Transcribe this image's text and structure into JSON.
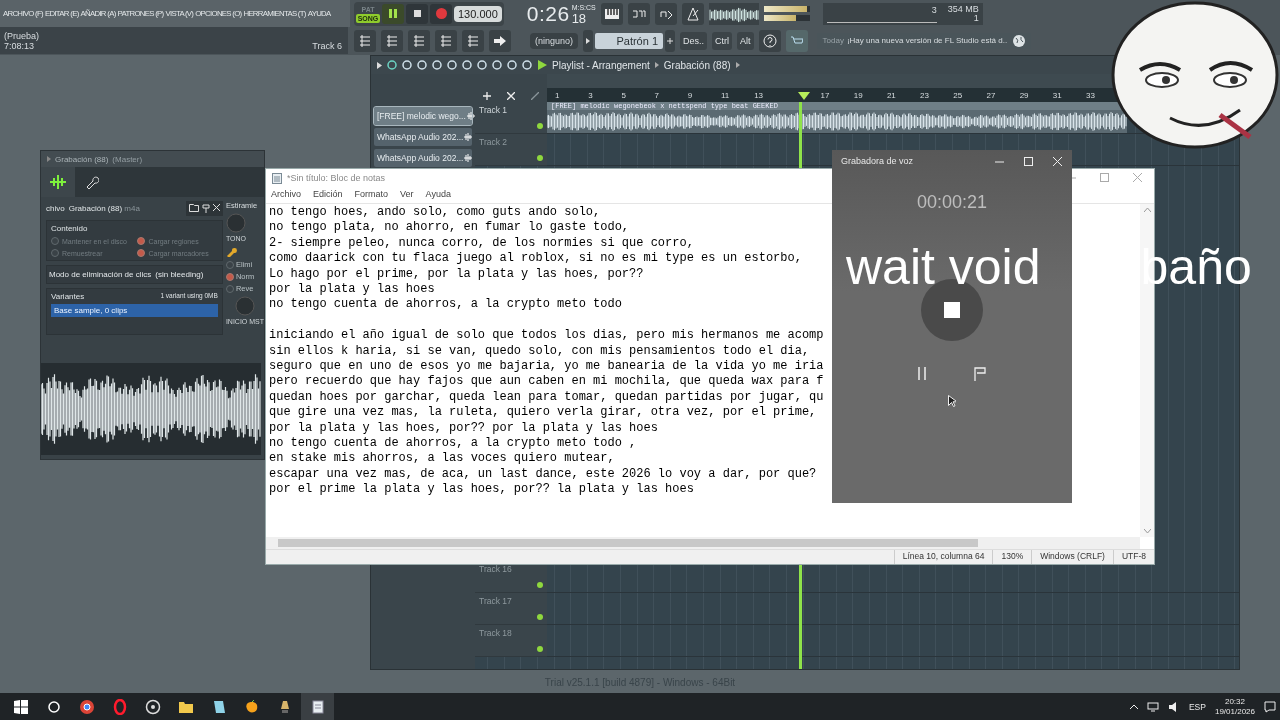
{
  "fl": {
    "menu": [
      "ARCHIVO (F)",
      "EDITAR (E)",
      "AÑADIR (A)",
      "PATRONES (P)",
      "VISTA (V)",
      "OPCIONES (O)",
      "HERRAMIENTAS (T)",
      "AYUDA"
    ],
    "hint": {
      "title": "(Prueba)",
      "value": "7:08:13",
      "track": "Track 6"
    },
    "transport": {
      "pat": "PAT",
      "song": "SONG",
      "song_mode": true,
      "playing": true,
      "tempo": "130.000",
      "time": "0:26",
      "time_cs": "18",
      "time_unit": "M:S:CS"
    },
    "sliders": [
      {
        "level": 0.93
      },
      {
        "level": 0.7
      }
    ],
    "monitor": {
      "cpu": "3",
      "memory": "354 MB",
      "polyphony": "1"
    },
    "pattern": {
      "none_label": "(ninguno)",
      "name": "Patrón 1"
    },
    "keys": [
      "Des..",
      "Ctrl",
      "Alt"
    ],
    "news": {
      "tag": "Today",
      "text": "¡Hay una nueva versión de FL Studio está d.."
    }
  },
  "playlist": {
    "title": "Playlist - Arrangement",
    "crumb": "Grabación (88)",
    "ruler": [
      {
        "kind": "number",
        "label": "1"
      },
      {
        "kind": "number",
        "label": "3"
      },
      {
        "kind": "number",
        "label": "5"
      },
      {
        "kind": "number",
        "label": "7"
      },
      {
        "kind": "number",
        "label": "9"
      },
      {
        "kind": "number",
        "label": "11"
      },
      {
        "kind": "number",
        "label": "13"
      },
      {
        "kind": "marker"
      },
      {
        "kind": "number",
        "label": "17"
      },
      {
        "kind": "number",
        "label": "19"
      },
      {
        "kind": "number",
        "label": "21"
      },
      {
        "kind": "number",
        "label": "23"
      },
      {
        "kind": "number",
        "label": "25"
      },
      {
        "kind": "number",
        "label": "27"
      },
      {
        "kind": "number",
        "label": "29"
      },
      {
        "kind": "number",
        "label": "31"
      },
      {
        "kind": "number",
        "label": "33"
      }
    ],
    "sources": [
      {
        "name": "[FREE] melodic wego...",
        "selected": true
      },
      {
        "name": "WhatsApp Audio 202...",
        "selected": false
      },
      {
        "name": "WhatsApp Audio 202...",
        "selected": false
      }
    ],
    "top_tracks": [
      {
        "name": "Track 1",
        "clip": "[FREE] melodic wegonebeok x nettspend type beat GEEKED"
      },
      {
        "name": "Track 2"
      }
    ],
    "bottom_tracks": [
      {
        "name": "Track 16"
      },
      {
        "name": "Track 17"
      },
      {
        "name": "Track 18"
      }
    ]
  },
  "sample_window": {
    "title": "Grabación (88)",
    "subtitle": "(Master)",
    "file_label": "chivo",
    "file_name": "Grabación (88)",
    "file_ext": "m4a",
    "stretch_label": "Estiramie",
    "content_title": "Contenido",
    "options": [
      {
        "label": "Mantener en el disco",
        "checked": false
      },
      {
        "label": "Cargar regiones",
        "checked": true
      },
      {
        "label": "Remuestrear",
        "checked": false
      },
      {
        "label": "Cargar marcadores",
        "checked": true
      }
    ],
    "declick_label": "Modo de eliminación de clics",
    "declick_value": "(sin bleeding)",
    "knobs": [
      "TONO",
      "INICIO MST"
    ],
    "modes": [
      {
        "label": "Elimi",
        "selected": false
      },
      {
        "label": "Norm",
        "selected": true
      },
      {
        "label": "Reve",
        "selected": false
      }
    ],
    "variants_title": "Variantes",
    "variants_info": "1 variant using 0MB",
    "variants": [
      {
        "label": "Base sample, 0 clips",
        "selected": true
      }
    ]
  },
  "notepad": {
    "title": "*Sin título: Bloc de notas",
    "menu": [
      "Archivo",
      "Edición",
      "Formato",
      "Ver",
      "Ayuda"
    ],
    "paragraphs": [
      [
        "no tengo hoes, ando solo, como guts ando solo,",
        "no tengo plata, no ahorro, en fumar lo gaste todo,",
        "2- siempre peleo, nunca corro, de los normies si que corro,",
        "como daarick con tu flaca juego al roblox, si no es mi type es un estorbo,",
        "Lo hago por el prime, por la plata y las hoes, por??",
        "por la plata y las hoes",
        "no tengo cuenta de ahorros, a la crypto meto todo"
      ],
      [
        "iniciando el año igual de solo que todos los dias, pero mis hermanos me acomp",
        "sin ellos k haria, si se van, quedo solo, con mis pensamientos todo el dia,",
        "seguro que en uno de esos yo me bajaria, yo me banearia de la vida yo me iria",
        "pero recuerdo que hay fajos que aun caben en mi mochila, que queda wax para f",
        "quedan hoes por garchar, queda lean para tomar, quedan partidas por jugar, qu",
        "que gire una vez mas, la ruleta, quiero verla girar, otra vez, por el prime,",
        "por la plata y las hoes, por?? por la plata y las hoes",
        "no tengo cuenta de ahorros, a la crypto meto todo ,",
        "en stake mis ahorros, a las voces quiero mutear,",
        "escapar una vez mas, de aca, un last dance, este 2026 lo voy a dar, por que?",
        "por el prime la plata y las hoes, por?? la plata y las hoes"
      ]
    ],
    "status": [
      "Línea 10, columna 64",
      "130%",
      "Windows (CRLF)",
      "UTF-8"
    ]
  },
  "recorder": {
    "title": "Grabadora de voz",
    "timer": "00:00:21"
  },
  "caption": [
    "wait void",
    "baño"
  ],
  "trial_line": "Trial v25.1.1 [build 4879] - Windows - 64Bit",
  "taskbar": {
    "language": "ESP",
    "time": "20:32",
    "date": "19/01/2026"
  }
}
